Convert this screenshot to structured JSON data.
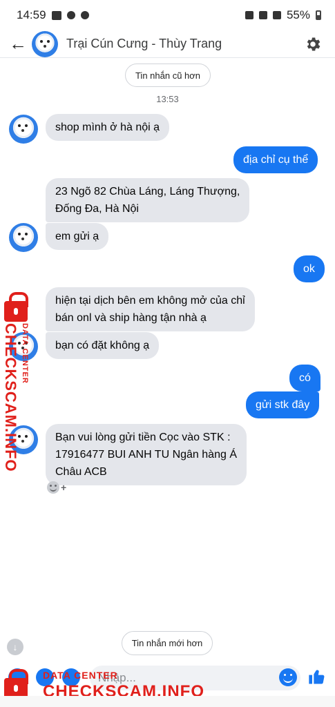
{
  "status_bar": {
    "time": "14:59",
    "battery": "55%"
  },
  "header": {
    "title": "Trại Cún Cưng - Thùy Trang"
  },
  "older_button": "Tin nhắn cũ hơn",
  "timestamp": "13:53",
  "messages": [
    {
      "side": "in",
      "lines": [
        "shop mình ở hà nội ạ"
      ]
    },
    {
      "side": "out",
      "lines": [
        "địa chỉ cụ thể"
      ]
    },
    {
      "side": "in",
      "lines": [
        "23 Ngõ 82 Chùa Láng, Láng Thượng,",
        "Đống Đa, Hà Nội"
      ]
    },
    {
      "side": "in",
      "lines": [
        "em gửi ạ"
      ]
    },
    {
      "side": "out",
      "lines": [
        "ok"
      ]
    },
    {
      "side": "in",
      "lines": [
        "hiện tại dịch bên em không mở của chỉ",
        "bán onl và ship hàng tận nhà ạ"
      ]
    },
    {
      "side": "in",
      "lines": [
        "bạn có đặt không ạ"
      ]
    },
    {
      "side": "out",
      "lines": [
        "có"
      ]
    },
    {
      "side": "out",
      "lines": [
        "gửi stk đây"
      ]
    },
    {
      "side": "in",
      "lines": [
        "Bạn vui lòng gửi tiền Cọc vào STK :",
        "17916477 BUI ANH TU Ngân hàng Á",
        "Châu ACB"
      ]
    }
  ],
  "reaction_plus": "+",
  "newer_button": "Tin nhắn mới hơn",
  "composer": {
    "placeholder": "Nhập..."
  },
  "watermark": {
    "small": "DATA CENTER",
    "big": "CHECKSCAM.INFO"
  },
  "icons": {
    "back": "arrow-left-icon",
    "settings": "gear-icon",
    "emoji": "smile-icon",
    "like": "thumbs-up-icon",
    "scroll": "arrow-down-icon"
  },
  "colors": {
    "accent": "#1877f2",
    "incoming": "#e4e6eb",
    "watermark": "#e0201b"
  }
}
